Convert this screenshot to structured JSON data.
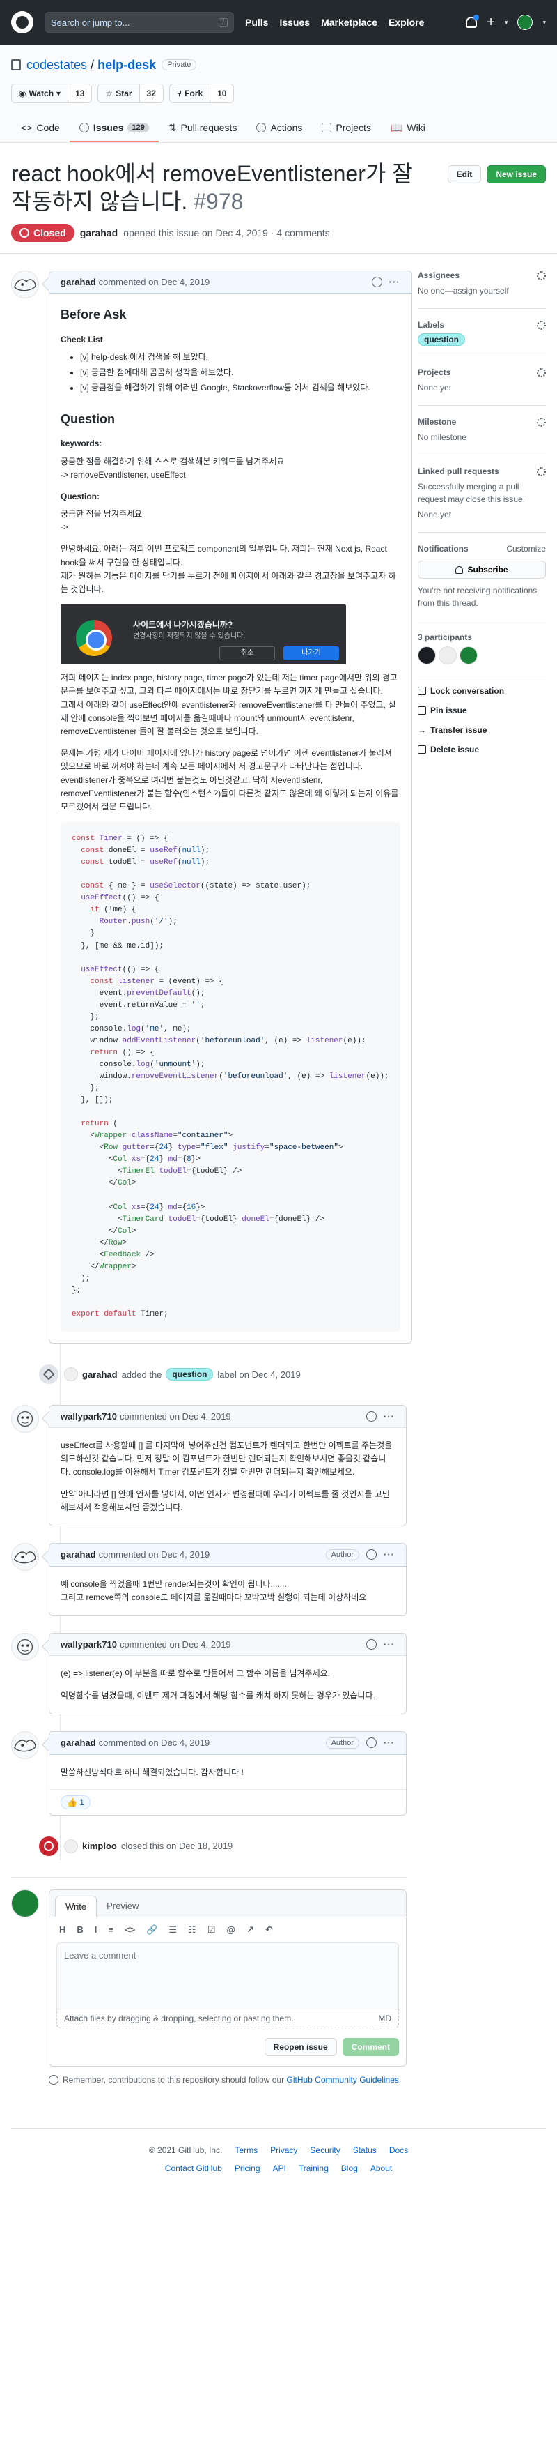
{
  "header": {
    "search_placeholder": "Search or jump to...",
    "search_key": "/",
    "nav": [
      "Pulls",
      "Issues",
      "Marketplace",
      "Explore"
    ]
  },
  "repo": {
    "owner": "codestates",
    "sep": "/",
    "name": "help-desk",
    "visibility": "Private",
    "watch_label": "Watch",
    "watch_count": "13",
    "star_label": "Star",
    "star_count": "32",
    "fork_label": "Fork",
    "fork_count": "10",
    "tabs": [
      {
        "label": "Code"
      },
      {
        "label": "Issues",
        "count": "129"
      },
      {
        "label": "Pull requests"
      },
      {
        "label": "Actions"
      },
      {
        "label": "Projects"
      },
      {
        "label": "Wiki"
      }
    ]
  },
  "issue": {
    "title": "react hook에서 removeEventlistener가 잘 작동하지 않습니다.",
    "number": "#978",
    "edit_label": "Edit",
    "new_issue_label": "New issue",
    "status": "Closed",
    "author": "garahad",
    "opened_text": "opened this issue on Dec 4, 2019 · 4 comments"
  },
  "comments": [
    {
      "author": "garahad",
      "date": "commented on Dec 4, 2019",
      "body": {
        "h_before": "Before Ask",
        "h_check": "Check List",
        "checklist": [
          "[v] help-desk 에서 검색을 해 보았다.",
          "[v] 궁금한 점에대해 곰곰히 생각을 해보았다.",
          "[v] 궁금점을 해결하기 위해 여러번 Google, Stackoverflow등 에서 검색을 해보았다."
        ],
        "h_question": "Question",
        "h_keywords": "keywords:",
        "keywords_p1": "궁금한 점을 해결하기 위해 스스로 검색해본 키워드를 남겨주세요",
        "keywords_p2": "-> removeEventlistener, useEffect",
        "h_q2": "Question:",
        "q_p1": "궁금한 점을 남겨주세요",
        "q_p2": "->",
        "para1": "안녕하세요, 아래는 저희 이번 프로젝트 component의 일부입니다. 저희는 현재 Next js, React hook을 써서 구현을 한 상태입니다.",
        "para2": "제가 원하는 기능은 페이지를 닫기를 누르기 전에 페이지에서 아래와 같은 경고창을 보여주고자 하는 것입니다.",
        "dialog_title": "사이트에서 나가시겠습니까?",
        "dialog_sub": "변경사항이 저장되지 않을 수 있습니다.",
        "dialog_cancel": "취소",
        "dialog_leave": "나가기",
        "para3": "저희 페이지는 index page, history page, timer page가 있는데 저는 timer page에서만 위의 경고 문구를 보여주고 싶고, 그외 다른 페이지에서는 바로 창닫기를 누르면 꺼지게 만들고 싶습니다.",
        "para4": "그래서 아래와 같이 useEffect안에 eventlistener와 removeEventlistener를 다 만들어 주었고, 실제 안에 console을 찍어보면 페이지를 옮길때마다 mount와 unmount시 eventlistenr, removeEventlistener 들이 잘 불러오는 것으로 보입니다.",
        "para5": "문제는 가령 제가 타이머 페이지에 있다가 history page로 넘어가면 이젠 eventlistener가 불러져 있으므로 바로 꺼져야 하는데 계속 모든 페이지에서 저 경고문구가 나타난다는 점입니다. eventlistener가 중복으로 여러번 붙는것도 아닌것같고, 딱히 저eventlistenr, removeEventlistener가 붙는 함수(인스턴스?)들이 다른것 같지도 않은데 왜 이렇게 되는지 이유를 모르겠어서 질문 드립니다."
      }
    },
    {
      "author": "wallypark710",
      "date": "commented on Dec 4, 2019",
      "p1": "useEffect를 사용할때 [] 를 마지막에 넣어주신건 컴포넌트가 렌더되고 한번만 이펙트를 주는것을 의도하신것 같습니다. 먼저 정말 이 컴포넌트가 한번만 렌더되는지 확인해보시면 좋을것 같습니다. console.log를 이용해서 Timer 컴포넌트가 정말 한번만 렌더되는지 확인해보세요.",
      "p2": "만약 아니라면 [] 안에 인자를 넣어서, 어떤 인자가 변경될때에 우리가 이펙트를 줄 것인지를 고민해보셔서 적용해보시면 좋겠습니다."
    },
    {
      "author": "garahad",
      "date": "commented on Dec 4, 2019",
      "role": "Author",
      "p1": "예 console을 찍었을때 1번만 render되는것이 확인이 됩니다.......",
      "p2": "그리고 remove쪽의 console도 페이지를 옮길때마다 꼬박꼬박 실행이 되는데 이상하네요"
    },
    {
      "author": "wallypark710",
      "date": "commented on Dec 4, 2019",
      "p1": "(e) => listener(e) 이 부분을 따로 함수로 만들어서 그 함수 이름을 넘겨주세요.",
      "p2": "익명함수를 넘겼을때, 이벤트 제거 과정에서 해당 함수를 캐치 하지 못하는 경우가 있습니다."
    },
    {
      "author": "garahad",
      "date": "commented on Dec 4, 2019",
      "role": "Author",
      "p1": "말씀하신방식대로 하니 해결되었습니다. 감사합니다 !",
      "reaction_emoji": "👍",
      "reaction_count": "1"
    }
  ],
  "events": {
    "label_actor": "garahad",
    "label_text": "added the",
    "label_name": "question",
    "label_suffix": "label on Dec 4, 2019",
    "closed_actor": "kimploo",
    "closed_text": "closed this on Dec 18, 2019"
  },
  "composer": {
    "write_tab": "Write",
    "preview_tab": "Preview",
    "toolbar": [
      "H",
      "B",
      "I",
      "≡",
      "<>",
      "🔗",
      "☰",
      "☷",
      "☑",
      "@",
      "↗",
      "↶"
    ],
    "placeholder": "Leave a comment",
    "attach_text": "Attach files by dragging & dropping, selecting or pasting them.",
    "md_badge": "MD",
    "reopen_label": "Reopen issue",
    "comment_label": "Comment",
    "tip_prefix": "Remember, contributions to this repository should follow our",
    "tip_link": "GitHub Community Guidelines",
    "tip_suffix": "."
  },
  "sidebar": {
    "assignees_title": "Assignees",
    "assignees_value": "No one—assign yourself",
    "labels_title": "Labels",
    "labels_value": "question",
    "projects_title": "Projects",
    "projects_value": "None yet",
    "milestone_title": "Milestone",
    "milestone_value": "No milestone",
    "linked_title": "Linked pull requests",
    "linked_value": "Successfully merging a pull request may close this issue.",
    "linked_value2": "None yet",
    "notif_title": "Notifications",
    "notif_customize": "Customize",
    "subscribe_label": "Subscribe",
    "notif_text": "You're not receiving notifications from this thread.",
    "participants_title": "3 participants",
    "lock_label": "Lock conversation",
    "pin_label": "Pin issue",
    "transfer_label": "Transfer issue",
    "delete_label": "Delete issue"
  },
  "footer": {
    "copyright": "© 2021 GitHub, Inc.",
    "row1": [
      "Terms",
      "Privacy",
      "Security",
      "Status",
      "Docs"
    ],
    "row2": [
      "Contact GitHub",
      "Pricing",
      "API",
      "Training",
      "Blog",
      "About"
    ]
  },
  "colors": {
    "closed": "#d73a49",
    "accent": "#0366d6",
    "green": "#2ea44f",
    "label_question": "#a2eeef"
  }
}
